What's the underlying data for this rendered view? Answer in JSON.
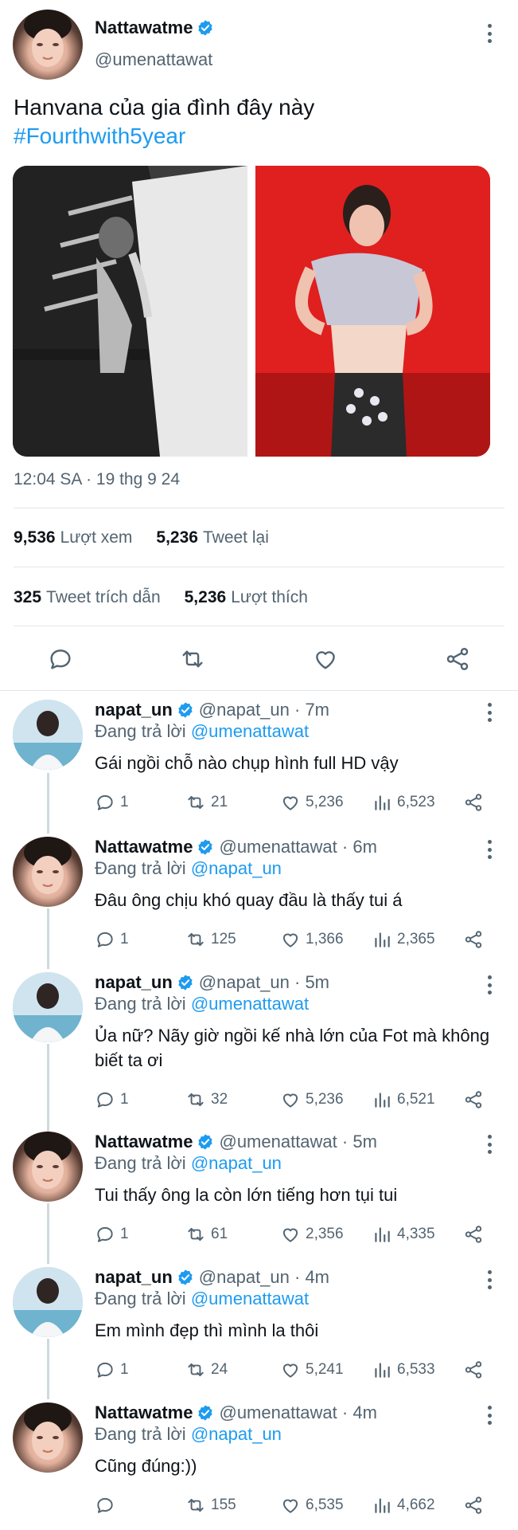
{
  "main_tweet": {
    "author_name": "Nattawatme",
    "author_handle": "@umenattawat",
    "text": "Hanvana của gia đình đây này",
    "hashtag": "#Fourthwith5year",
    "timestamp": "12:04 SA · 19 thg 9 24",
    "views_count": "9,536",
    "views_label": "Lượt xem",
    "retweets_count": "5,236",
    "retweets_label": "Tweet lại",
    "quotes_count": "325",
    "quotes_label": "Tweet trích dẫn",
    "likes_count": "5,236",
    "likes_label": "Lượt thích"
  },
  "replies": [
    {
      "name": "napat_un",
      "handle": "@napat_un · 7m",
      "replying_prefix": "Đang trả lời",
      "replying_to": "@umenattawat",
      "text": "Gái ngồi chỗ nào chụp hình full HD vậy",
      "replies": "1",
      "retweets": "21",
      "likes": "5,236",
      "views": "6,523"
    },
    {
      "name": "Nattawatme",
      "handle": "@umenattawat · 6m",
      "replying_prefix": "Đang trả lời",
      "replying_to": "@napat_un",
      "text": "Đâu ông chịu khó quay đầu là thấy tui á",
      "replies": "1",
      "retweets": "125",
      "likes": "1,366",
      "views": "2,365"
    },
    {
      "name": "napat_un",
      "handle": "@napat_un · 5m",
      "replying_prefix": "Đang trả lời",
      "replying_to": "@umenattawat",
      "text": "Ủa nữ? Nãy giờ ngồi kế nhà lớn của Fot mà không biết ta ơi",
      "replies": "1",
      "retweets": "32",
      "likes": "5,236",
      "views": "6,521"
    },
    {
      "name": "Nattawatme",
      "handle": "@umenattawat · 5m",
      "replying_prefix": "Đang trả lời",
      "replying_to": "@napat_un",
      "text": "Tui thấy ông la còn lớn tiếng hơn tụi tui",
      "replies": "1",
      "retweets": "61",
      "likes": "2,356",
      "views": "4,335"
    },
    {
      "name": "napat_un",
      "handle": "@napat_un · 4m",
      "replying_prefix": "Đang trả lời",
      "replying_to": "@umenattawat",
      "text": "Em mình đẹp thì mình la thôi",
      "replies": "1",
      "retweets": "24",
      "likes": "5,241",
      "views": "6,533"
    },
    {
      "name": "Nattawatme",
      "handle": "@umenattawat · 4m",
      "replying_prefix": "Đang trả lời",
      "replying_to": "@napat_un",
      "text": "Cũng đúng:))",
      "replies": "",
      "retweets": "155",
      "likes": "6,535",
      "views": "4,662"
    }
  ],
  "colors": {
    "accent": "#1d9bf0",
    "secondary_text": "#536471",
    "primary_text": "#0f1419",
    "divider": "#e1e6ea"
  },
  "icons": [
    "verified-badge-icon",
    "more-options-icon",
    "reply-icon",
    "retweet-icon",
    "like-icon",
    "share-icon",
    "views-icon"
  ]
}
